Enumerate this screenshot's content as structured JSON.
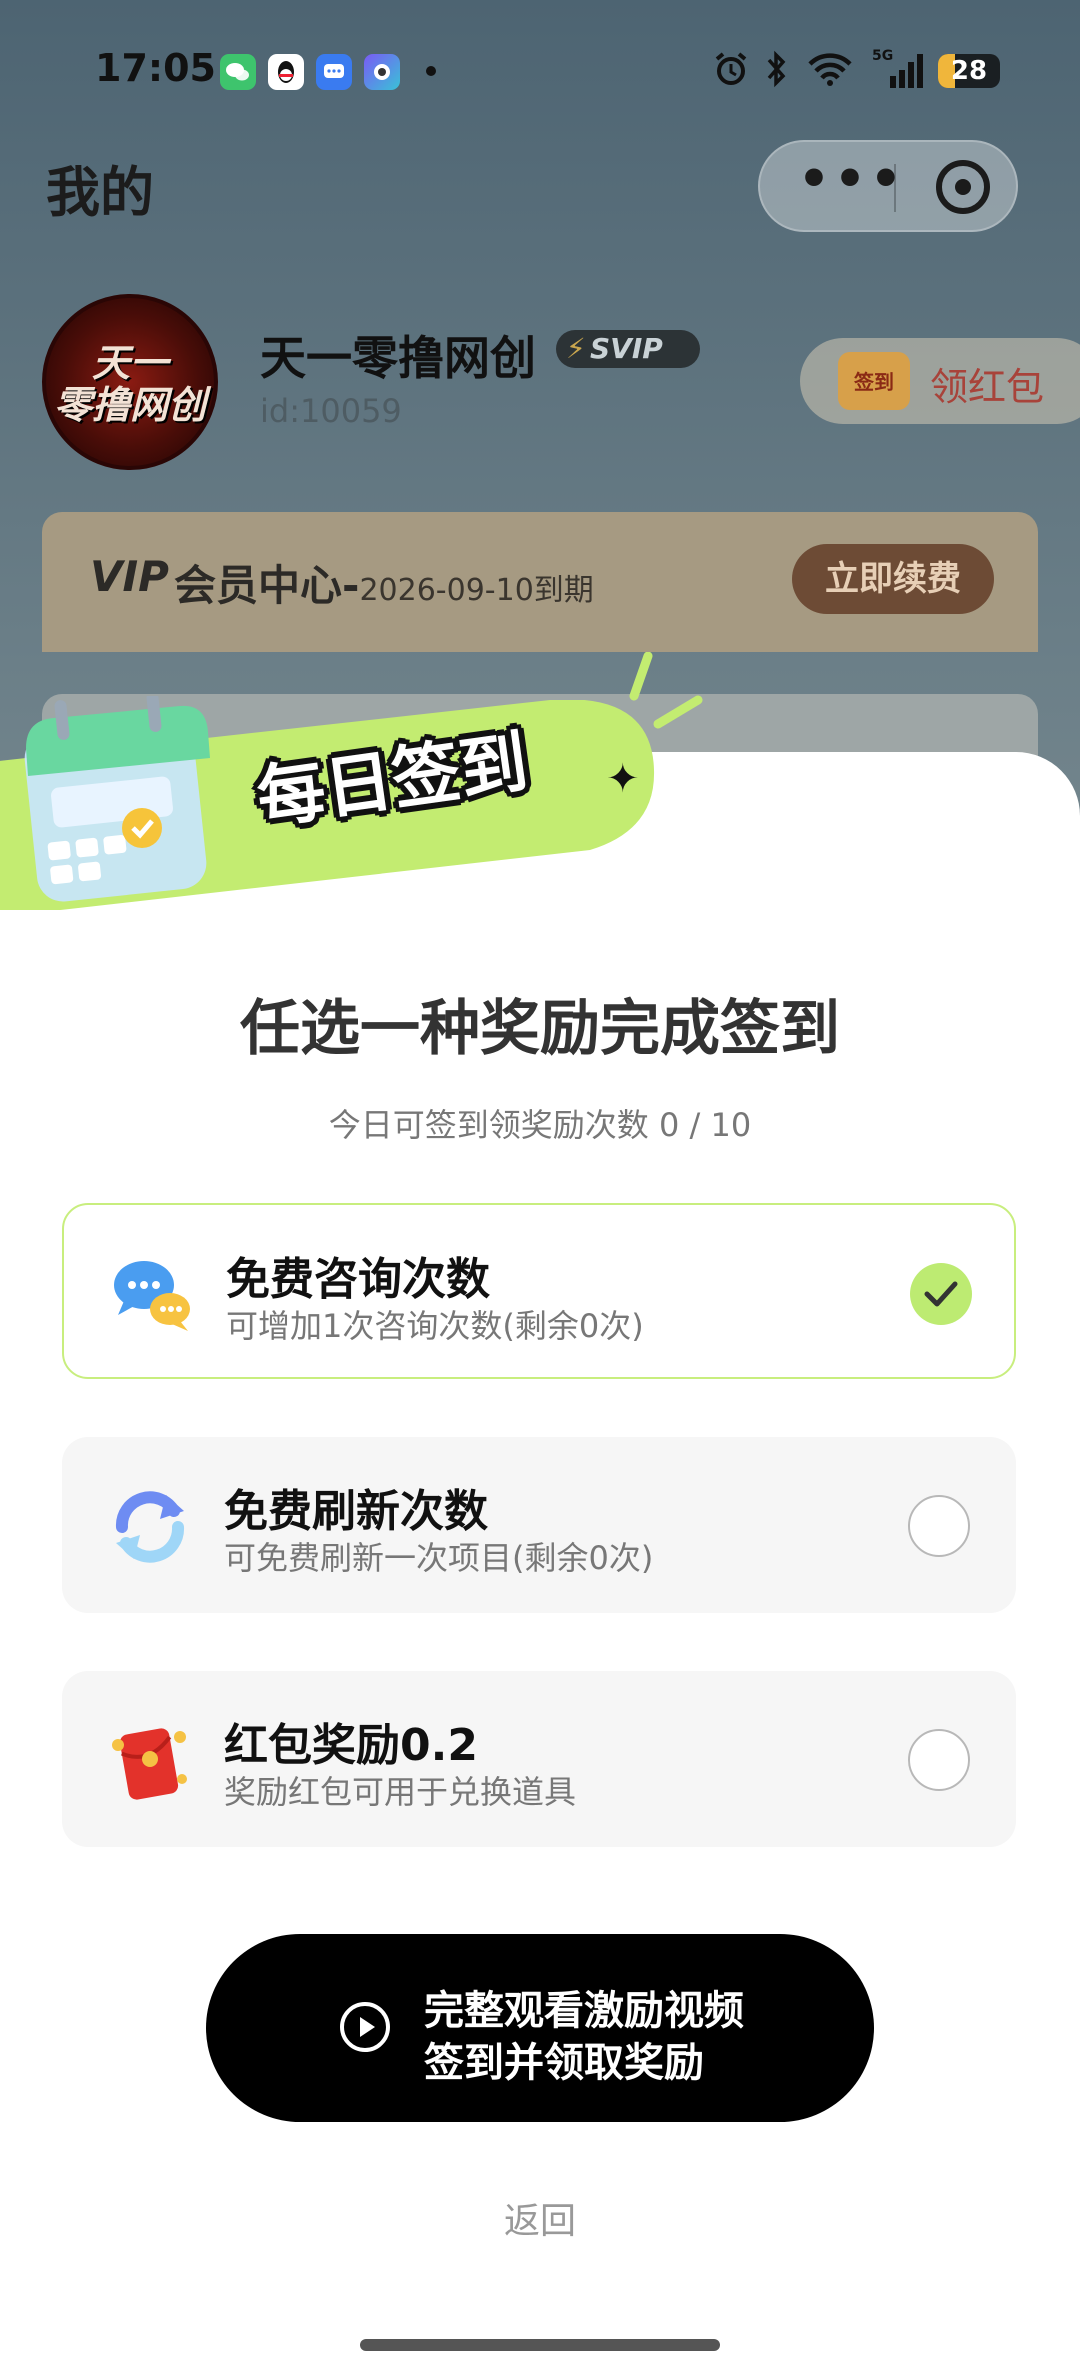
{
  "status_bar": {
    "time": "17:05",
    "battery": "28",
    "battery_level": 0.28,
    "network": "5G",
    "app_icons": [
      "wechat-icon",
      "qq-icon",
      "message-icon",
      "camera-app-icon"
    ],
    "system_icons": [
      "alarm-icon",
      "bluetooth-icon",
      "wifi-icon",
      "signal-icon"
    ]
  },
  "header": {
    "title": "我的"
  },
  "profile": {
    "avatar_text": "天一\n零撸网创",
    "username": "天一零撸网创",
    "badge": "SVIP",
    "user_id": "id:10059",
    "redpacket_badge": "签到",
    "redpacket_label": "领红包"
  },
  "vip": {
    "logo": "VIP",
    "title": "会员中心-",
    "expiry": "2026-09-10到期",
    "renew_label": "立即续费"
  },
  "checkin": {
    "banner_title": "每日签到",
    "title": "任选一种奖励完成签到",
    "subtitle": "今日可签到领奖励次数 0 / 10",
    "options": [
      {
        "title": "免费咨询次数",
        "desc": "可增加1次咨询次数(剩余0次)",
        "icon": "chat-bubbles-icon",
        "selected": true
      },
      {
        "title": "免费刷新次数",
        "desc": "可免费刷新一次项目(剩余0次)",
        "icon": "refresh-icon",
        "selected": false
      },
      {
        "title": "红包奖励0.2",
        "desc": "奖励红包可用于兑换道具",
        "icon": "red-envelope-icon",
        "selected": false
      }
    ],
    "watch_button_line1": "完整观看激励视频",
    "watch_button_line2": "签到并领取奖励",
    "back_label": "返回"
  },
  "colors": {
    "accent_green": "#bdeb72",
    "selected_border": "#c8ee7e",
    "button_black": "#000000"
  }
}
